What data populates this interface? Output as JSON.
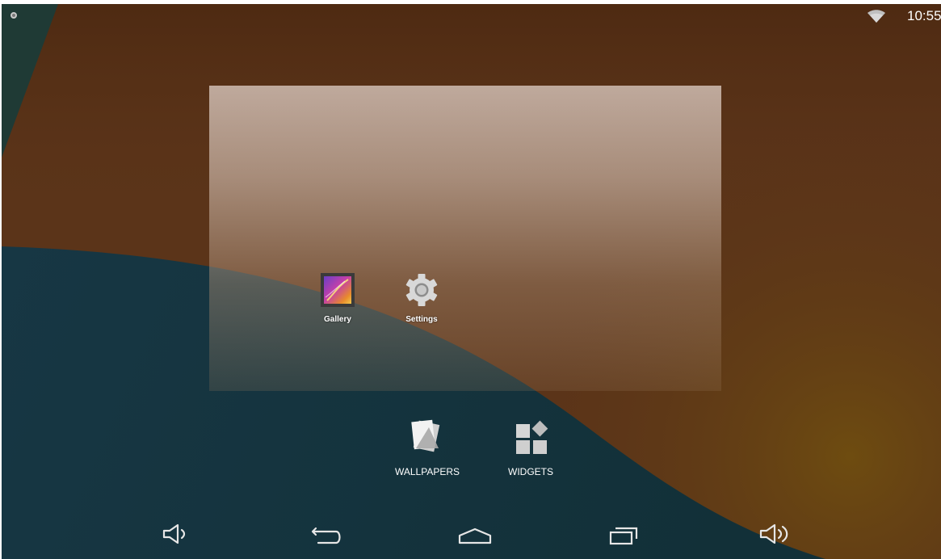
{
  "status_bar": {
    "clock": "10:55",
    "icons": [
      "notification-dot-icon",
      "wifi-icon"
    ]
  },
  "desktop": {
    "apps": [
      {
        "label": "Gallery",
        "icon": "gallery-icon"
      },
      {
        "label": "Settings",
        "icon": "settings-gear-icon"
      }
    ]
  },
  "overview": {
    "wallpapers_label": "WALLPAPERS",
    "widgets_label": "WIDGETS"
  },
  "nav_bar": {
    "buttons": [
      "volume-down-icon",
      "back-icon",
      "home-icon",
      "recent-apps-icon",
      "volume-up-icon"
    ]
  },
  "colors": {
    "wallpaper_brown": "#5a3318",
    "wallpaper_teal": "#16343d",
    "wallpaper_amber": "#6b4a12",
    "text": "#ffffff"
  }
}
